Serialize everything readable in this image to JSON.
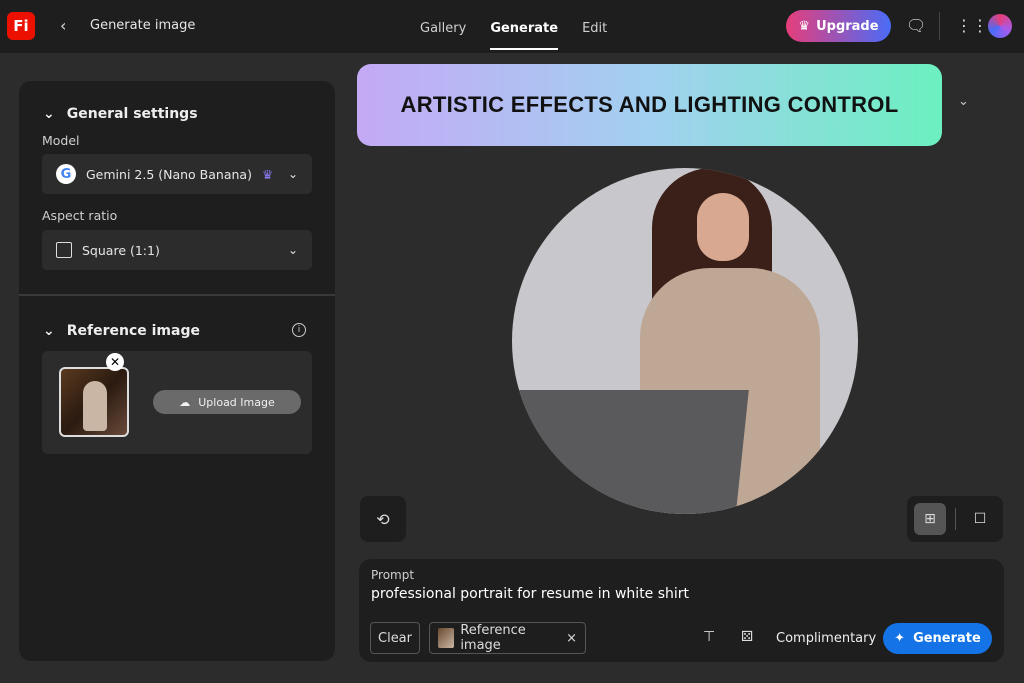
{
  "app": {
    "logo_text": "Fi",
    "page_title": "Generate image"
  },
  "nav": {
    "tabs": [
      {
        "label": "Gallery"
      },
      {
        "label": "Generate"
      },
      {
        "label": "Edit"
      }
    ],
    "upgrade_label": "Upgrade"
  },
  "sidebar": {
    "general": {
      "title": "General settings",
      "model_label": "Model",
      "model_value": "Gemini 2.5 (Nano Banana)",
      "aspect_label": "Aspect ratio",
      "aspect_value": "Square (1:1)"
    },
    "reference": {
      "title": "Reference image",
      "upload_label": "Upload Image"
    }
  },
  "banner": {
    "text": "ARTISTIC EFFECTS AND LIGHTING CONTROL"
  },
  "prompt": {
    "label": "Prompt",
    "value": "professional portrait for resume in white shirt",
    "clear_label": "Clear",
    "reference_chip": "Reference image",
    "credits_label": "Complimentary",
    "generate_label": "Generate"
  },
  "colors": {
    "accent": "#1473e6",
    "logo": "#eb1000"
  }
}
